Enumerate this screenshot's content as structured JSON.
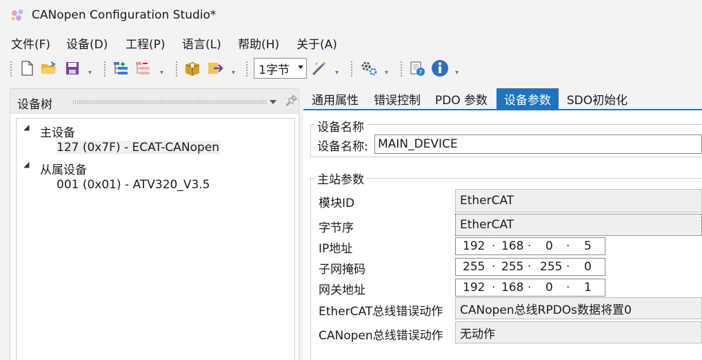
{
  "window": {
    "title": "CANopen Configuration Studio*"
  },
  "menu": [
    "文件(F)",
    "设备(D)",
    "工程(P)",
    "语言(L)",
    "帮助(H)",
    "关于(A)"
  ],
  "toolbar": {
    "combo_value": "1字节",
    "icons": [
      "new-icon",
      "open-icon",
      "save-icon",
      "add-node-icon",
      "remove-node-icon",
      "package-icon",
      "import-icon",
      "wand-icon",
      "settings-icon",
      "help-icon",
      "info-icon"
    ]
  },
  "left_panel": {
    "title": "设备树",
    "tree": {
      "master_group": "主设备",
      "master_node": "127 (0x7F)  -  ECAT-CANopen",
      "slave_group": "从属设备",
      "slave_node": "001 (0x01)  -  ATV320_V3.5"
    }
  },
  "tabs": [
    "通用属性",
    "错误控制",
    "PDO 参数",
    "设备参数",
    "SDO初始化"
  ],
  "active_tab": "设备参数",
  "device_name_group": {
    "title": "设备名称",
    "label": "设备名称:",
    "value": "MAIN_DEVICE"
  },
  "master_params": {
    "title": "主站参数",
    "module_id_label": "模块ID",
    "module_id_value": "EtherCAT",
    "byte_order_label": "字节序",
    "byte_order_value": "EtherCAT",
    "ip_label": "IP地址",
    "ip": [
      "192",
      "168",
      "0",
      "5"
    ],
    "mask_label": "子网掩码",
    "mask": [
      "255",
      "255",
      "255",
      "0"
    ],
    "gateway_label": "网关地址",
    "gateway": [
      "192",
      "168",
      "0",
      "1"
    ],
    "ecat_error_label": "EtherCAT总线错误动作",
    "ecat_error_value": "CANopen总线RPDOs数据将置0",
    "canopen_error_label": "CANopen总线错误动作",
    "canopen_error_value": "无动作"
  },
  "colors": {
    "accent": "#1e73be",
    "background": "#f3f3f3"
  }
}
